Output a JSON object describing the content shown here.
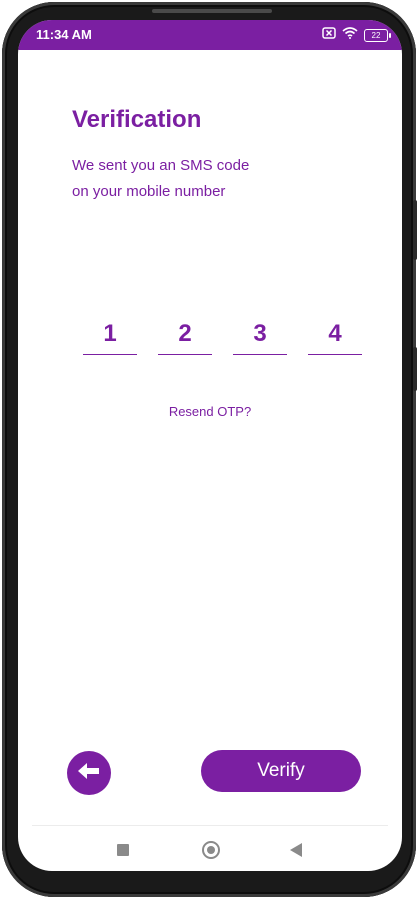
{
  "status_bar": {
    "time": "11:34 AM",
    "battery_level": "22",
    "icons": [
      "sim-off-icon",
      "wifi-icon",
      "battery-icon"
    ]
  },
  "screen": {
    "title": "Verification",
    "subtitle_line1": "We sent you an SMS code",
    "subtitle_line2": "on your mobile number",
    "otp_digits": [
      "1",
      "2",
      "3",
      "4"
    ],
    "resend_link": "Resend OTP?",
    "back_button_icon": "arrow-left-icon",
    "verify_button": "Verify"
  },
  "nav_bar": {
    "icons": [
      "recents-square-icon",
      "home-circle-icon",
      "back-triangle-icon"
    ]
  },
  "colors": {
    "accent": "#7b1fa2",
    "background": "#ffffff",
    "nav_icon": "#8a8a8a"
  }
}
